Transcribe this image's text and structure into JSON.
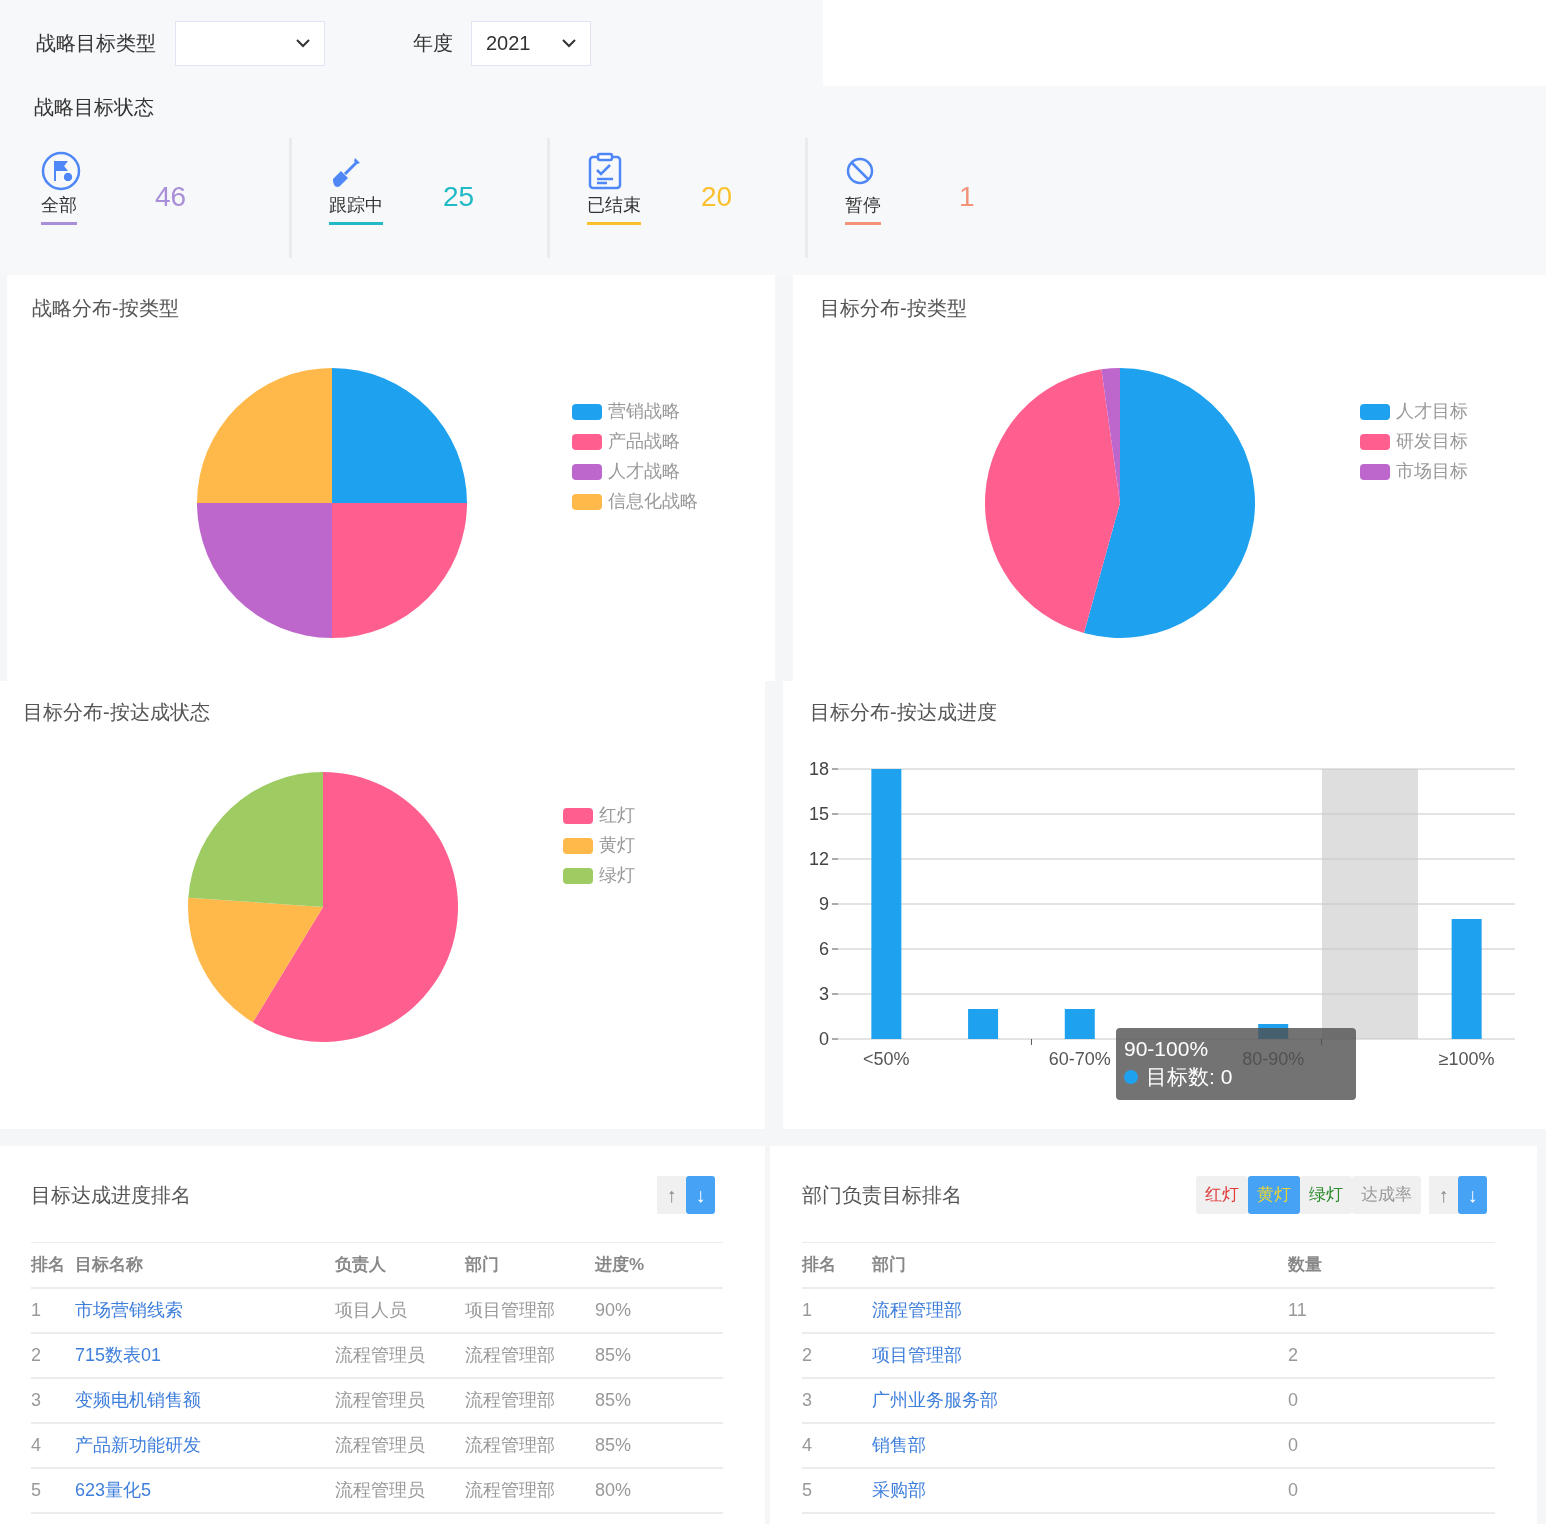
{
  "filters": [
    {
      "label": "战略目标类型"
    },
    {
      "label": "年度",
      "value": "2021"
    }
  ],
  "status_title": "战略目标状态",
  "status_items": [
    {
      "kind": "all",
      "label": "全部",
      "count": "46",
      "color": "#a98ed8"
    },
    {
      "kind": "tracking",
      "label": "跟踪中",
      "count": "25",
      "color": "#1fbac6"
    },
    {
      "kind": "finished",
      "label": "已结束",
      "count": "20",
      "color": "#fbc02d"
    },
    {
      "kind": "paused",
      "label": "暂停",
      "count": "1",
      "color": "#f3937a"
    }
  ],
  "charts": [
    {
      "title": "战略分布-按类型",
      "chart_data": {
        "type": "pie",
        "categories": [
          "营销战略",
          "产品战略",
          "人才战略",
          "信息化战略"
        ],
        "series": [
          {
            "values": [
              25,
              25,
              25,
              25
            ]
          }
        ],
        "colors": [
          "#1ea1ef",
          "#ff5f8e",
          "#bd67cc",
          "#ffb84a"
        ],
        "legend": "right"
      }
    },
    {
      "title": "目标分布-按类型",
      "chart_data": {
        "type": "pie",
        "categories": [
          "人才目标",
          "研发目标",
          "市场目标"
        ],
        "series": [
          {
            "values": [
              54.3,
              43.5,
              2.2
            ]
          }
        ],
        "colors": [
          "#1ea1ef",
          "#ff5f8e",
          "#bd67cc"
        ],
        "legend": "right"
      }
    },
    {
      "title": "目标分布-按达成状态",
      "chart_data": {
        "type": "pie",
        "categories": [
          "红灯",
          "黄灯",
          "绿灯"
        ],
        "series": [
          {
            "values": [
              58.7,
              17.4,
              23.9
            ]
          }
        ],
        "colors": [
          "#ff5f8e",
          "#ffb84a",
          "#9ecb62"
        ],
        "legend": "right"
      }
    },
    {
      "title": "目标分布-按达成进度",
      "chart_data": {
        "type": "bar",
        "categories": [
          "<50%",
          null,
          "60-70%",
          null,
          "80-90%",
          null,
          "≥100%"
        ],
        "series": [
          {
            "color": "#1ea1ef",
            "values": [
              18,
              2,
              2,
              0,
              1,
              0,
              8
            ]
          }
        ],
        "ylim": [
          0,
          18
        ],
        "yticks": [
          0,
          3,
          6,
          9,
          12,
          15,
          18
        ],
        "grid": true
      },
      "tooltip": {
        "title": "90-100%",
        "text": "目标数: 0",
        "column_highlight": true
      }
    }
  ],
  "goal_ranking": {
    "title": "目标达成进度排名",
    "sort_buttons": [
      {
        "label": "↑",
        "selected": false
      },
      {
        "label": "↓",
        "selected": true
      }
    ],
    "columns": [
      "排名",
      "目标名称",
      "负责人",
      "部门",
      "进度%"
    ],
    "rows": [
      [
        "1",
        "市场营销线索",
        "项目人员",
        "项目管理部",
        "90%"
      ],
      [
        "2",
        "715数表01",
        "流程管理员",
        "流程管理部",
        "85%"
      ],
      [
        "3",
        "变频电机销售额",
        "流程管理员",
        "流程管理部",
        "85%"
      ],
      [
        "4",
        "产品新功能研发",
        "流程管理员",
        "流程管理部",
        "85%"
      ],
      [
        "5",
        "623量化5",
        "流程管理员",
        "流程管理部",
        "80%"
      ]
    ]
  },
  "dept_ranking": {
    "title": "部门负责目标排名",
    "filter_buttons": [
      {
        "kind": "red",
        "label": "红灯",
        "selected": false
      },
      {
        "kind": "yellow",
        "label": "黄灯",
        "selected": true
      },
      {
        "kind": "green",
        "label": "绿灯",
        "selected": false
      },
      {
        "kind": "rate",
        "label": "达成率",
        "selected": false
      }
    ],
    "sort_buttons": [
      {
        "label": "↑",
        "selected": false
      },
      {
        "label": "↓",
        "selected": true
      }
    ],
    "columns": [
      "排名",
      "部门",
      "数量"
    ],
    "rows": [
      [
        "1",
        "流程管理部",
        "11"
      ],
      [
        "2",
        "项目管理部",
        "2"
      ],
      [
        "3",
        "广州业务服务部",
        "0"
      ],
      [
        "4",
        "销售部",
        "0"
      ],
      [
        "5",
        "采购部",
        "0"
      ]
    ]
  }
}
